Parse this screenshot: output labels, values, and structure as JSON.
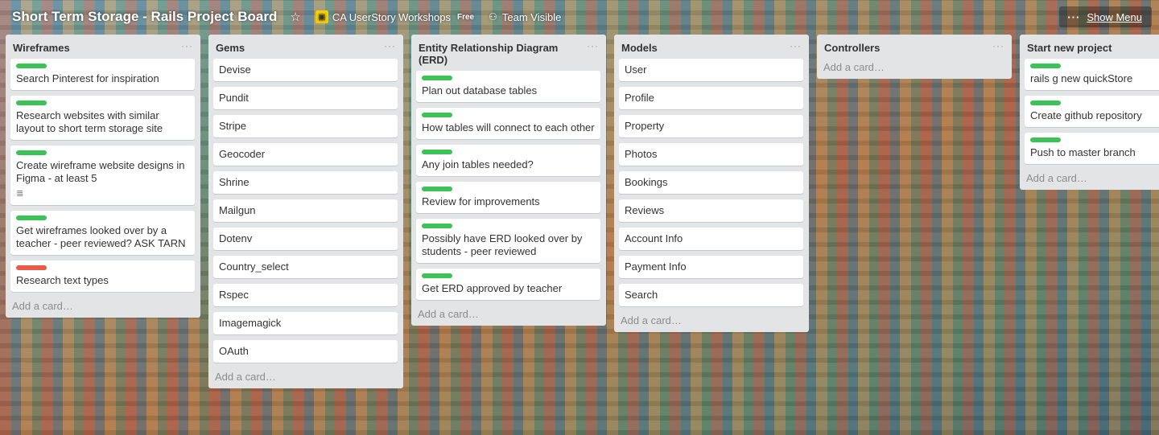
{
  "header": {
    "board_title": "Short Term Storage - Rails Project Board",
    "star_glyph": "☆",
    "org_name": "CA UserStory Workshops",
    "free_badge": "Free",
    "visibility": "Team Visible",
    "menu_dots": "···",
    "show_menu": "Show Menu"
  },
  "colors": {
    "green_label": "#3cc257",
    "red_label": "#eb5a46",
    "list_bg": "#e2e4e6"
  },
  "lists": [
    {
      "title": "Wireframes",
      "menu": "···",
      "add_card": "Add a card…",
      "cards": [
        {
          "text": "Search Pinterest for inspiration",
          "label": "green"
        },
        {
          "text": "Research websites with similar layout to short term storage site",
          "label": "green"
        },
        {
          "text": "Create wireframe website designs in Figma - at least 5",
          "label": "green",
          "has_description": true
        },
        {
          "text": "Get wireframes looked over by a teacher - peer reviewed? ASK TARN",
          "label": "green"
        },
        {
          "text": "Research text types",
          "label": "red"
        }
      ]
    },
    {
      "title": "Gems",
      "menu": "···",
      "add_card": "Add a card…",
      "cards": [
        {
          "text": "Devise"
        },
        {
          "text": "Pundit"
        },
        {
          "text": "Stripe"
        },
        {
          "text": "Geocoder"
        },
        {
          "text": "Shrine"
        },
        {
          "text": "Mailgun"
        },
        {
          "text": "Dotenv"
        },
        {
          "text": "Country_select"
        },
        {
          "text": "Rspec"
        },
        {
          "text": "Imagemagick"
        },
        {
          "text": "OAuth"
        }
      ]
    },
    {
      "title": "Entity Relationship Diagram (ERD)",
      "menu": "···",
      "add_card": "Add a card…",
      "cards": [
        {
          "text": "Plan out database tables",
          "label": "green"
        },
        {
          "text": "How tables will connect to each other",
          "label": "green"
        },
        {
          "text": "Any join tables needed?",
          "label": "green"
        },
        {
          "text": "Review for improvements",
          "label": "green"
        },
        {
          "text": "Possibly have ERD looked over by students - peer reviewed",
          "label": "green"
        },
        {
          "text": "Get ERD approved by teacher",
          "label": "green"
        }
      ]
    },
    {
      "title": "Models",
      "menu": "···",
      "add_card": "Add a card…",
      "cards": [
        {
          "text": "User"
        },
        {
          "text": "Profile"
        },
        {
          "text": "Property"
        },
        {
          "text": "Photos"
        },
        {
          "text": "Bookings"
        },
        {
          "text": "Reviews"
        },
        {
          "text": "Account Info"
        },
        {
          "text": "Payment Info"
        },
        {
          "text": "Search"
        }
      ]
    },
    {
      "title": "Controllers",
      "menu": "···",
      "add_card": "Add a card…",
      "cards": []
    },
    {
      "title": "Start new project",
      "menu": "···",
      "add_card": "Add a card…",
      "cards": [
        {
          "text": "rails g new quickStore",
          "label": "green"
        },
        {
          "text": "Create github repository",
          "label": "green"
        },
        {
          "text": "Push to master branch",
          "label": "green"
        }
      ]
    }
  ],
  "icons": {
    "description": "≣"
  }
}
